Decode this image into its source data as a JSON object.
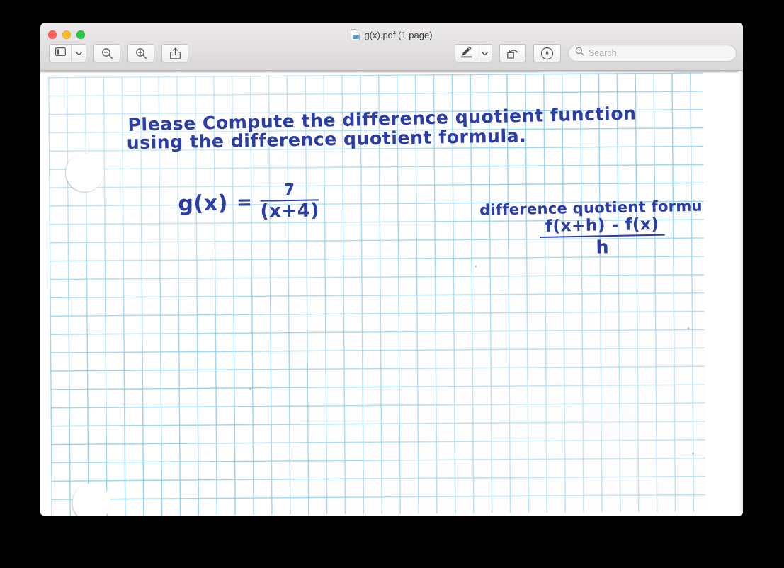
{
  "window": {
    "title": "g(x).pdf (1 page)",
    "title_icon": "pdf-document-icon",
    "traffic_lights": {
      "close": "close-window",
      "minimize": "minimize-window",
      "zoom": "zoom-window",
      "close_color": "#ff5f57",
      "minimize_color": "#febc2e",
      "zoom_color": "#28c840"
    }
  },
  "toolbar": {
    "left": [
      {
        "name": "sidebar-toggle",
        "icon": "sidebar-icon",
        "label": ""
      },
      {
        "name": "sidebar-menu",
        "icon": "chevron-down-icon",
        "label": ""
      },
      {
        "name": "zoom-out-button",
        "icon": "magnifier-minus-icon",
        "label": ""
      },
      {
        "name": "zoom-in-button",
        "icon": "magnifier-plus-icon",
        "label": ""
      },
      {
        "name": "share-button",
        "icon": "share-box-arrow-up-icon",
        "label": ""
      }
    ],
    "right": [
      {
        "name": "markup-pen-button",
        "icon": "highlighter-pen-icon",
        "label": ""
      },
      {
        "name": "markup-pen-menu",
        "icon": "chevron-down-icon",
        "label": ""
      },
      {
        "name": "rotate-button",
        "icon": "rotate-left-icon",
        "label": ""
      },
      {
        "name": "annotate-button",
        "icon": "pen-in-circle-icon",
        "label": ""
      }
    ],
    "search": {
      "icon": "search-icon",
      "placeholder": "Search",
      "value": ""
    }
  },
  "document": {
    "paper": "blue-graph-grid",
    "grid_color": "#78c8ec",
    "ink_color": "#2b3da4",
    "handwriting": {
      "prompt_line_1": "Please Compute the difference quotient function",
      "prompt_line_2": "using the difference  quotient formula.",
      "function": {
        "lhs": "g(x)",
        "equals": "=",
        "numerator": "7",
        "denominator": "(x+4)"
      },
      "formula": {
        "title": "difference quotient formula:",
        "numerator": "f(x+h) - f(x)",
        "denominator": "h"
      }
    }
  }
}
